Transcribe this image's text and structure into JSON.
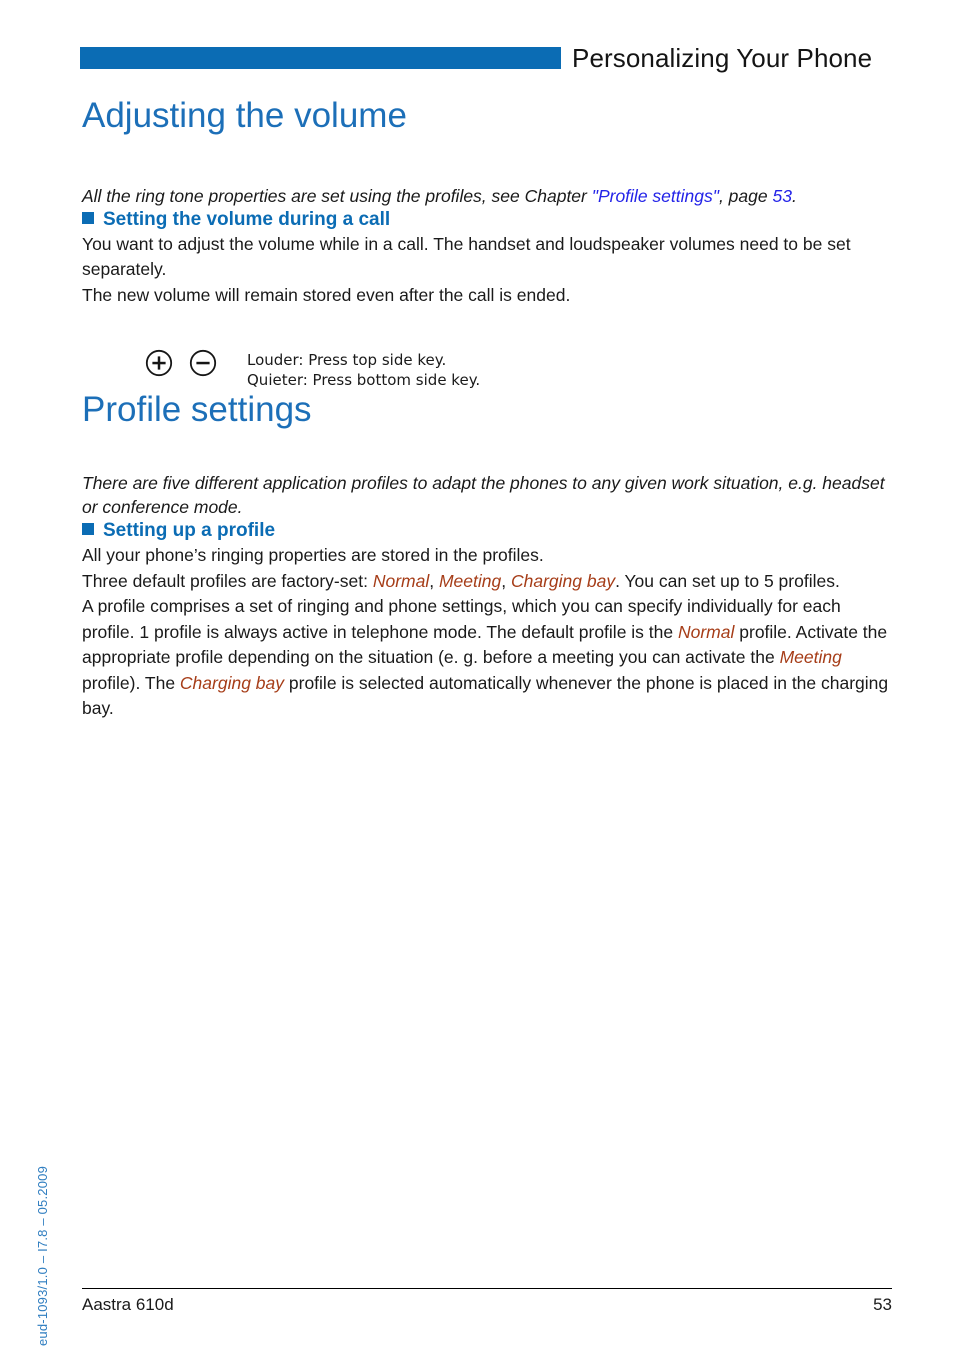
{
  "header": {
    "title": "Personalizing Your Phone",
    "rule_color": "#0B6CB4"
  },
  "chapter": {
    "title": "Adjusting the volume",
    "intro_before": "All the ring tone properties are set using the profiles, see Chapter ",
    "intro_link": "\"Profile settings\"",
    "intro_middle": ", page ",
    "intro_page_link": "53",
    "intro_after": "."
  },
  "section_volume": {
    "heading": "Setting the volume during a call",
    "paragraph_1": "You want to adjust the volume while in a call. The handset and loudspeaker volumes need to be set separately.",
    "paragraph_2": "The new volume will remain stored even after the call is ended.",
    "key_plus_icon": "plus-in-circle-icon",
    "key_minus_icon": "minus-in-circle-icon",
    "key_line_1": "Louder: Press top side key.",
    "key_line_2": "Quieter: Press bottom side key."
  },
  "chapter_profiles": {
    "title": "Profile settings",
    "intro": "There are five different application profiles to adapt the phones to any given work situation, e.g. headset or conference mode."
  },
  "section_profile": {
    "heading": "Setting up a profile",
    "paragraph_1": "All your phone’s ringing properties are stored in the profiles.",
    "p2_a": "Three default profiles are factory-set: ",
    "p2_profile_1": "Normal",
    "p2_b": ", ",
    "p2_profile_2": "Meeting",
    "p2_c": ", ",
    "p2_profile_3": "Charging bay",
    "p2_d": ". You can set up to 5 profiles.",
    "p3_a": "A profile comprises a set of ringing and phone settings, which you can specify individually for each profile. 1 profile is always active in telephone mode. The default profile is the ",
    "p3_profile_1": "Normal",
    "p3_b": " profile. Activate the appropriate profile depending on the situation (e. g. before a meeting you can activate the ",
    "p3_profile_2": "Meeting",
    "p3_c": " profile). The ",
    "p3_profile_3": "Charging bay",
    "p3_d": " profile is selected automatically whenever the phone is placed in the charging bay."
  },
  "margin": {
    "doc_id": "eud-1093/1.0 – I7.8 – 05.2009"
  },
  "footer": {
    "product": "Aastra 610d",
    "page_number": "53"
  },
  "colors": {
    "brand_blue": "#0B6CB4",
    "heading_blue": "#1C6FB8",
    "link_blue": "#2323E8",
    "profile_orange": "#A63D18",
    "text_black": "#1a1a1a"
  }
}
